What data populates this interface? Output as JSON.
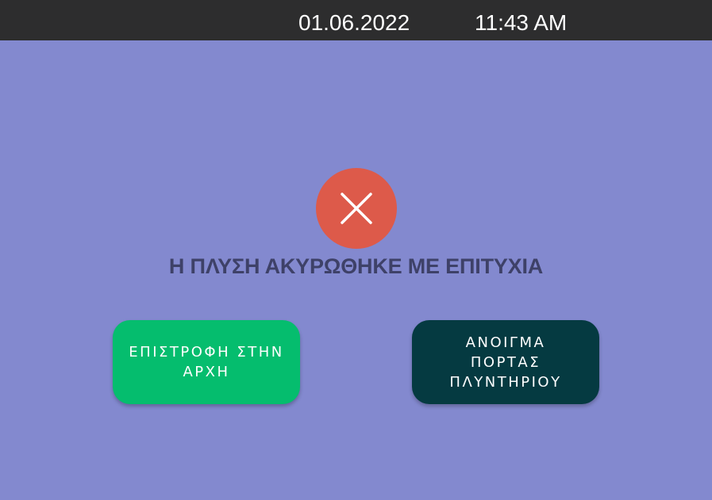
{
  "status_bar": {
    "date": "01.06.2022",
    "time": "11:43 AM"
  },
  "icon": {
    "name": "close-icon",
    "circle_color": "#dd5a4a",
    "glyph_color": "#ffffff"
  },
  "message": "Η ΠΛΥΣΗ ΑΚΥΡΩΘΗΚΕ ΜΕ ΕΠΙΤΥΧΙΑ",
  "buttons": {
    "home": {
      "label": "ΕΠΙΣΤΡΟΦΗ ΣΤΗΝ\nΑΡΧΗ",
      "color": "#05bd6e"
    },
    "door": {
      "label": "ΑΝΟΙΓΜΑ\nΠΟΡΤΑΣ\nΠΛΥΝΤΗΡΙΟΥ",
      "color": "#053a41"
    }
  },
  "colors": {
    "background": "#8389cf",
    "status_bar": "#2d2d2e",
    "message_text": "#3e4168"
  }
}
